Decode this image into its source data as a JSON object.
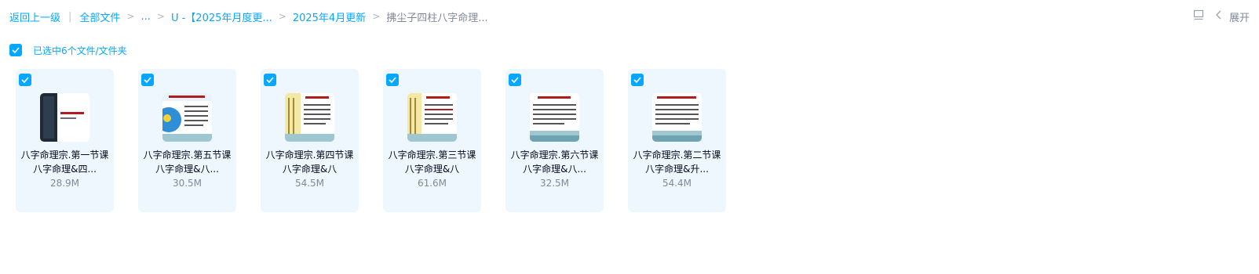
{
  "breadcrumb": {
    "back": "返回上一级",
    "all_files": "全部文件",
    "ellipsis": "...",
    "folder1": "U -【2025年月度更...",
    "folder2": "2025年4月更新",
    "current": "拂尘子四柱八字命理..."
  },
  "toolbar": {
    "expand_label": "展开"
  },
  "selection": {
    "label": "已选中6个文件/文件夹"
  },
  "files": [
    {
      "name": "八字命理宗.第一节课 八字命理&四...",
      "size": "28.9M",
      "thumb": "dark"
    },
    {
      "name": "八字命理宗.第五节课 八字命理&八...",
      "size": "30.5M",
      "thumb": "blue"
    },
    {
      "name": "八字命理宗.第四节课 八字命理&八",
      "size": "54.5M",
      "thumb": "yellow"
    },
    {
      "name": "八字命理宗.第三节课 八字命理&八",
      "size": "61.6M",
      "thumb": "yellow"
    },
    {
      "name": "八字命理宗.第六节课 八字命理&八...",
      "size": "32.5M",
      "thumb": "text"
    },
    {
      "name": "八字命理宗.第二节课 八字命理&升...",
      "size": "54.4M",
      "thumb": "text"
    }
  ],
  "colors": {
    "accent": "#06a7ff",
    "card_bg": "#eef7fe",
    "muted": "#818999",
    "text": "#03081a"
  }
}
